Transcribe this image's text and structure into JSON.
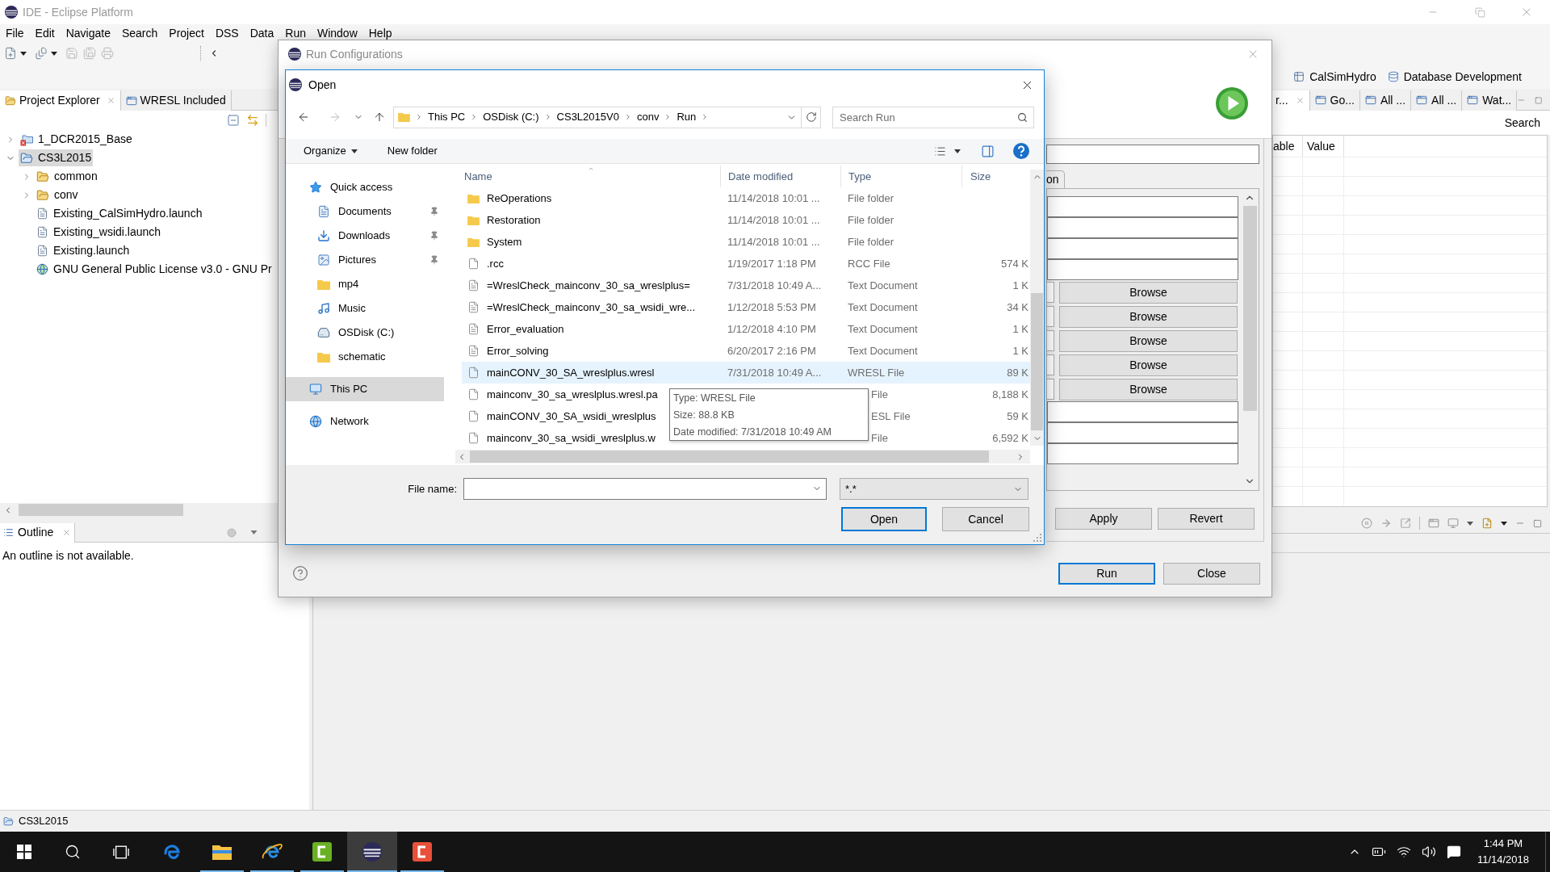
{
  "window": {
    "title": "IDE - Eclipse Platform"
  },
  "menu_bar": [
    "File",
    "Edit",
    "Navigate",
    "Search",
    "Project",
    "DSS",
    "Data",
    "Run",
    "Window",
    "Help"
  ],
  "perspectives": [
    {
      "label": "CalSimHydro",
      "kind": "table"
    },
    {
      "label": "Database Development",
      "kind": "database"
    }
  ],
  "project_explorer": {
    "tabs": [
      {
        "label": "Project Explorer",
        "kind": "explorer",
        "selected": true
      },
      {
        "label": "WRESL Included",
        "kind": "view",
        "selected": false
      }
    ],
    "tree": [
      {
        "label": "1_DCR2015_Base",
        "kind": "project_error",
        "expanded": false,
        "selected": false
      },
      {
        "label": "CS3L2015",
        "kind": "project",
        "expanded": true,
        "selected": true,
        "children": [
          {
            "label": "common",
            "kind": "folder",
            "expanded": false,
            "selected": false
          },
          {
            "label": "conv",
            "kind": "folder",
            "expanded": false,
            "selected": false
          },
          {
            "label": "Existing_CalSimHydro.launch",
            "kind": "file",
            "selected": false
          },
          {
            "label": "Existing_wsidi.launch",
            "kind": "file",
            "selected": false
          },
          {
            "label": "Existing.launch",
            "kind": "file",
            "selected": false
          },
          {
            "label": "GNU General Public License v3.0 - GNU Pr",
            "kind": "link",
            "selected": false
          }
        ]
      }
    ]
  },
  "outline": {
    "tab": "Outline",
    "message": "An outline is not available."
  },
  "right_view": {
    "tabs": [
      {
        "label": "r...",
        "selected": true
      },
      {
        "label": "Go...",
        "selected": false
      },
      {
        "label": "All ...",
        "selected": false
      },
      {
        "label": "All ...",
        "selected": false
      },
      {
        "label": "Wat...",
        "selected": false
      }
    ],
    "search_label": "Search",
    "columns": [
      "able",
      "Value"
    ]
  },
  "status_bar": {
    "text": "CS3L2015"
  },
  "run_configurations": {
    "title": "Run Configurations",
    "tab": "on",
    "form_rows": [
      {
        "kind": "field"
      },
      {
        "kind": "field"
      },
      {
        "kind": "field"
      },
      {
        "kind": "field"
      },
      {
        "kind": "browse",
        "button": "Browse"
      },
      {
        "kind": "browse",
        "button": "Browse"
      },
      {
        "kind": "browse",
        "button": "Browse"
      },
      {
        "kind": "browse",
        "button": "Browse"
      },
      {
        "kind": "browse",
        "button": "Browse"
      },
      {
        "kind": "field"
      },
      {
        "kind": "field"
      },
      {
        "kind": "field"
      }
    ],
    "buttons": [
      {
        "label": "Apply",
        "default": false
      },
      {
        "label": "Revert",
        "default": false
      }
    ],
    "footer_buttons": [
      {
        "label": "Run",
        "default": true
      },
      {
        "label": "Close",
        "default": false
      }
    ]
  },
  "open_dialog": {
    "title": "Open",
    "breadcrumb": [
      "This PC",
      "OSDisk (C:)",
      "CS3L2015V0",
      "conv",
      "Run"
    ],
    "search": {
      "placeholder": "Search Run"
    },
    "commands": [
      {
        "label": "Organize",
        "kind": "menu"
      },
      {
        "label": "New folder",
        "kind": "button"
      }
    ],
    "nav_pane": [
      {
        "label": "Quick access",
        "kind": "star",
        "selected": false,
        "children": [
          {
            "label": "Documents",
            "kind": "documents",
            "pinned": true,
            "selected": false
          },
          {
            "label": "Downloads",
            "kind": "downloads",
            "pinned": true,
            "selected": false
          },
          {
            "label": "Pictures",
            "kind": "pictures",
            "pinned": true,
            "selected": false
          },
          {
            "label": "mp4",
            "kind": "folder",
            "pinned": false,
            "selected": false
          },
          {
            "label": "Music",
            "kind": "music",
            "pinned": false,
            "selected": false
          },
          {
            "label": "OSDisk (C:)",
            "kind": "drive",
            "pinned": false,
            "selected": false
          },
          {
            "label": "schematic",
            "kind": "folder",
            "pinned": false,
            "selected": false
          }
        ]
      },
      {
        "label": "This PC",
        "kind": "pc",
        "selected": true
      },
      {
        "label": "Network",
        "kind": "network",
        "selected": false
      }
    ],
    "columns": [
      {
        "label": "Name",
        "sorted": true
      },
      {
        "label": "Date modified",
        "sorted": false
      },
      {
        "label": "Type",
        "sorted": false
      },
      {
        "label": "Size",
        "sorted": false
      }
    ],
    "rows": [
      {
        "kind": "folder",
        "name": "ReOperations",
        "date": "11/14/2018 10:01 ...",
        "type": "File folder",
        "hovered": false
      },
      {
        "kind": "folder",
        "name": "Restoration",
        "date": "11/14/2018 10:01 ...",
        "type": "File folder",
        "hovered": false
      },
      {
        "kind": "folder",
        "name": "System",
        "date": "11/14/2018 10:01 ...",
        "type": "File folder",
        "hovered": false
      },
      {
        "kind": "file",
        "name": ".rcc",
        "date": "1/19/2017 1:18 PM",
        "type": "RCC File",
        "size": "574 K",
        "hovered": false
      },
      {
        "kind": "text",
        "name": "=WreslCheck_mainconv_30_sa_wreslplus=",
        "date": "7/31/2018 10:49 A...",
        "type": "Text Document",
        "size": "1 K",
        "hovered": false
      },
      {
        "kind": "text",
        "name": "=WreslCheck_mainconv_30_sa_wsidi_wre...",
        "date": "1/12/2018 5:53 PM",
        "type": "Text Document",
        "size": "34 K",
        "hovered": false
      },
      {
        "kind": "text",
        "name": "Error_evaluation",
        "date": "1/12/2018 4:10 PM",
        "type": "Text Document",
        "size": "1 K",
        "hovered": false
      },
      {
        "kind": "text",
        "name": "Error_solving",
        "date": "6/20/2017 2:16 PM",
        "type": "Text Document",
        "size": "1 K",
        "hovered": false
      },
      {
        "kind": "file",
        "name": "mainCONV_30_SA_wreslplus.wresl",
        "date": "7/31/2018 10:49 A...",
        "type": "WRESL File",
        "size": "89 K",
        "hovered": true
      },
      {
        "kind": "file",
        "name": "mainconv_30_sa_wreslplus.wresl.pa",
        "type": "File",
        "size": "8,188 K",
        "hovered": false
      },
      {
        "kind": "file",
        "name": "mainCONV_30_SA_wsidi_wreslplus",
        "type": "ESL File",
        "size": "59 K",
        "hovered": false
      },
      {
        "kind": "file",
        "name": "mainconv_30_sa_wsidi_wreslplus.w",
        "type": "File",
        "size": "6,592 K",
        "hovered": false
      }
    ],
    "tooltip": [
      "Type: WRESL File",
      "Size: 88.8 KB",
      "Date modified: 7/31/2018 10:49 AM"
    ],
    "file_name": {
      "label": "File name:"
    },
    "file_type_filter": "*.*",
    "buttons": [
      {
        "label": "Open",
        "default": true
      },
      {
        "label": "Cancel",
        "default": false
      }
    ]
  },
  "taskbar": {
    "apps": [
      {
        "kind": "edge",
        "running": false,
        "active": false
      },
      {
        "kind": "explorer",
        "running": true,
        "active": false
      },
      {
        "kind": "ie",
        "running": true,
        "active": false
      },
      {
        "kind": "camtasia",
        "running": true,
        "active": false
      },
      {
        "kind": "eclipse",
        "running": true,
        "active": true
      },
      {
        "kind": "recorder",
        "running": true,
        "active": false
      }
    ],
    "clock": {
      "time": "1:44 PM",
      "date": "11/14/2018"
    }
  }
}
